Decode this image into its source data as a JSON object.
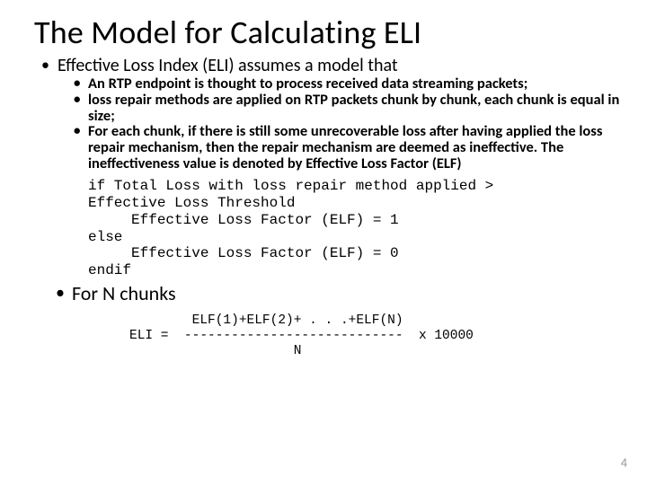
{
  "title": "The Model for Calculating ELI",
  "intro": "Effective Loss Index (ELI) assumes a model that",
  "bullets": [
    "An RTP endpoint is thought to process received data streaming packets;",
    "loss repair methods are applied on RTP packets chunk by chunk, each chunk is equal in size;",
    "For each chunk, if there is still some unrecoverable loss after having applied the loss repair mechanism, then the repair mechanism are deemed as ineffective. The ineffectiveness value is denoted by Effective Loss Factor (ELF)"
  ],
  "code": "if Total Loss with loss repair method applied >\nEffective Loss Threshold\n     Effective Loss Factor (ELF) = 1\nelse\n     Effective Loss Factor (ELF) = 0\nendif",
  "for_n": "For N chunks",
  "formula": "        ELF(1)+ELF(2)+ . . .+ELF(N)\nELI =  ----------------------------  x 10000\n                     N",
  "page": "4"
}
